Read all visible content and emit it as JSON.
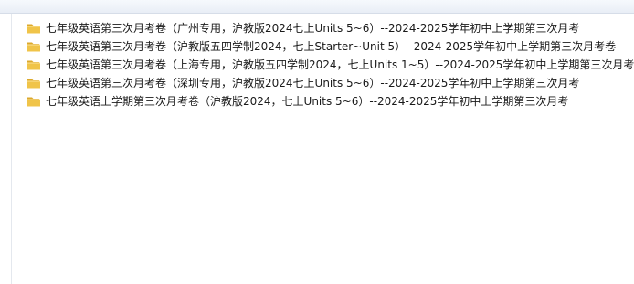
{
  "files": [
    {
      "name": "七年级英语第三次月考卷（广州专用，沪教版2024七上Units 5~6）--2024-2025学年初中上学期第三次月考",
      "icon": "folder-icon"
    },
    {
      "name": "七年级英语第三次月考卷（沪教版五四学制2024，七上Starter~Unit 5）--2024-2025学年初中上学期第三次月考卷",
      "icon": "folder-icon"
    },
    {
      "name": "七年级英语第三次月考卷（上海专用，沪教版五四学制2024，七上Units 1~5）--2024-2025学年初中上学期第三次月考卷",
      "icon": "folder-icon"
    },
    {
      "name": "七年级英语第三次月考卷（深圳专用，沪教版2024七上Units 5~6）--2024-2025学年初中上学期第三次月考",
      "icon": "folder-icon"
    },
    {
      "name": "七年级英语上学期第三次月考卷（沪教版2024，七上Units 5~6）--2024-2025学年初中上学期第三次月考",
      "icon": "folder-icon"
    }
  ],
  "colors": {
    "folder_body": "#f0c449",
    "folder_back": "#dca92c",
    "text": "#1a1a1a"
  }
}
